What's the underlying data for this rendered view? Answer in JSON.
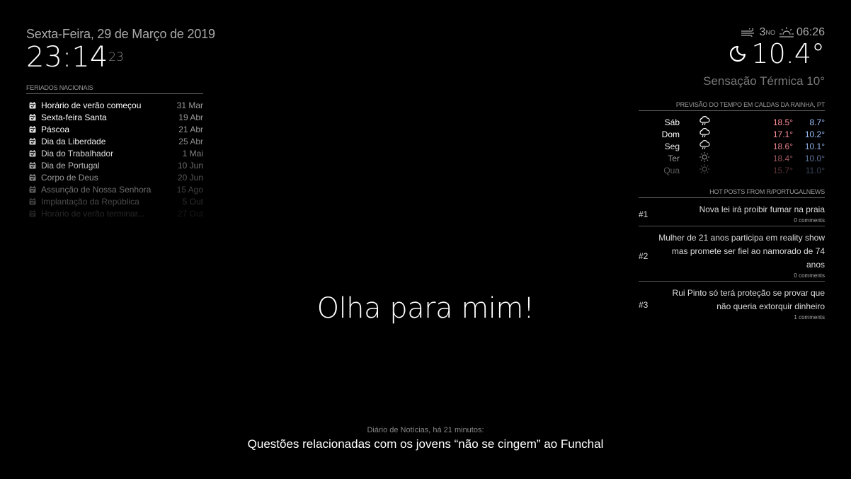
{
  "clock": {
    "date": "Sexta-Feira, 29 de Março de 2019",
    "time": "23:14",
    "seconds": "23"
  },
  "calendar": {
    "header": "FERIADOS NACIONAIS",
    "icon": "calendar-check-icon",
    "events": [
      {
        "title": "Horário de verão começou",
        "date": "31 Mar",
        "opacity": 1.0
      },
      {
        "title": "Sexta-feira Santa",
        "date": "19 Abr",
        "opacity": 1.0
      },
      {
        "title": "Páscoa",
        "date": "21 Abr",
        "opacity": 1.0
      },
      {
        "title": "Dia da Liberdade",
        "date": "25 Abr",
        "opacity": 0.92
      },
      {
        "title": "Dia do Trabalhador",
        "date": "1 Mai",
        "opacity": 0.84
      },
      {
        "title": "Dia de Portugal",
        "date": "10 Jun",
        "opacity": 0.72
      },
      {
        "title": "Corpo de Deus",
        "date": "20 Jun",
        "opacity": 0.58
      },
      {
        "title": "Assunção de Nossa Senhora",
        "date": "15 Ago",
        "opacity": 0.42
      },
      {
        "title": "Implantação da República",
        "date": "5 Out",
        "opacity": 0.28
      },
      {
        "title": "Horário de verão terminar...",
        "date": "27 Out",
        "opacity": 0.15
      }
    ]
  },
  "weather": {
    "wind_speed": "3",
    "wind_dir": "NO",
    "sun_time": "06:26",
    "temperature": "10.4°",
    "condition_icon": "moon-icon",
    "feels_like": "Sensação Térmica 10°"
  },
  "forecast": {
    "header": "PREVISÃO DO TEMPO EM CALDAS DA RAINHA, PT",
    "max_color": "#ff8e99",
    "min_color": "#9dc1ff",
    "days": [
      {
        "day": "Sáb",
        "icon": "rain-cloud-icon",
        "max": "18.5°",
        "min": "8.7°",
        "opacity": 1.0
      },
      {
        "day": "Dom",
        "icon": "rain-cloud-icon",
        "max": "17.1°",
        "min": "10.2°",
        "opacity": 1.0
      },
      {
        "day": "Seg",
        "icon": "rain-cloud-icon",
        "max": "18.6°",
        "min": "10.1°",
        "opacity": 0.9
      },
      {
        "day": "Ter",
        "icon": "sun-icon",
        "max": "18.4°",
        "min": "10.0°",
        "opacity": 0.6
      },
      {
        "day": "Qua",
        "icon": "sun-icon",
        "max": "15.7°",
        "min": "11.0°",
        "opacity": 0.35
      }
    ]
  },
  "reddit": {
    "header": "HOT POSTS FROM R/PORTUGALNEWS",
    "posts": [
      {
        "rank": "#1",
        "title": "Nova lei irá proibir fumar na praia",
        "comments": "0 comments"
      },
      {
        "rank": "#2",
        "title": "Mulher de 21 anos participa em reality show mas promete ser fiel ao namorado de 74 anos",
        "comments": "0 comments"
      },
      {
        "rank": "#3",
        "title": "Rui Pinto só terá proteção se provar que não queria extorquir dinheiro",
        "comments": "1 comments"
      }
    ]
  },
  "compliment": "Olha para mim!",
  "news": {
    "source": "Diário de Notícias, há 21 minutos:",
    "headline": "Questões relacionadas com os jovens “não se cingem” ao Funchal"
  }
}
